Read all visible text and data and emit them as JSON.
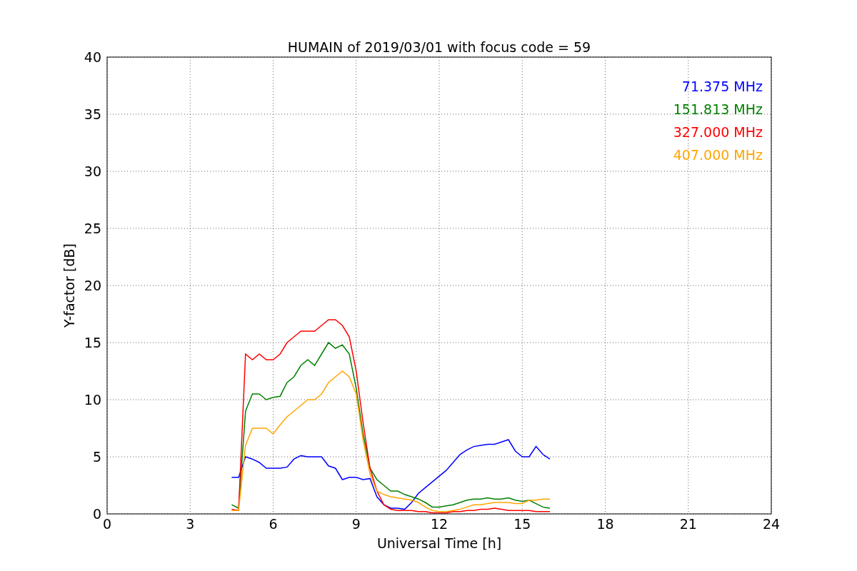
{
  "chart_data": {
    "type": "line",
    "title": "HUMAIN of 2019/03/01 with focus code = 59",
    "xlabel": "Universal Time [h]",
    "ylabel": "Y-factor [dB]",
    "x": [
      4.5,
      4.75,
      5,
      5.25,
      5.5,
      5.75,
      6,
      6.25,
      6.5,
      6.75,
      7,
      7.25,
      7.5,
      7.75,
      8,
      8.25,
      8.5,
      8.75,
      9,
      9.25,
      9.5,
      9.75,
      10,
      10.25,
      10.5,
      10.75,
      11,
      11.25,
      11.5,
      11.75,
      12,
      12.25,
      12.5,
      12.75,
      13,
      13.25,
      13.5,
      13.75,
      14,
      14.25,
      14.5,
      14.75,
      15,
      15.25,
      15.5,
      15.75,
      16
    ],
    "grid": true,
    "xlim": [
      0,
      24
    ],
    "ylim": [
      0,
      40
    ],
    "xticks": [
      0,
      3,
      6,
      9,
      12,
      15,
      18,
      21,
      24
    ],
    "yticks": [
      0,
      5,
      10,
      15,
      20,
      25,
      30,
      35,
      40
    ],
    "series": [
      {
        "name": "71.375 MHz",
        "color": "#0000ff",
        "values": [
          3.2,
          3.2,
          5,
          4.8,
          4.5,
          4,
          4,
          4,
          4.1,
          4.8,
          5.1,
          5,
          5,
          5,
          4.2,
          4,
          3,
          3.2,
          3.2,
          3,
          3.1,
          1.5,
          0.8,
          0.5,
          0.5,
          0.4,
          1,
          1.8,
          2.3,
          2.8,
          3.3,
          3.8,
          4.5,
          5.2,
          5.6,
          5.9,
          6,
          6.1,
          6.1,
          6.3,
          6.5,
          5.5,
          5,
          5,
          5.9,
          5.2,
          4.8
        ]
      },
      {
        "name": "151.813 MHz",
        "color": "#008000",
        "values": [
          0.8,
          0.5,
          9,
          10.5,
          10.5,
          10,
          10.2,
          10.3,
          11.5,
          12,
          13,
          13.5,
          13,
          14,
          15,
          14.5,
          14.8,
          14,
          11,
          7,
          4,
          3,
          2.5,
          2,
          2,
          1.7,
          1.5,
          1.3,
          1,
          0.6,
          0.6,
          0.7,
          0.8,
          1,
          1.2,
          1.3,
          1.3,
          1.4,
          1.3,
          1.3,
          1.4,
          1.2,
          1.1,
          1.2,
          0.9,
          0.6,
          0.5
        ]
      },
      {
        "name": "327.000 MHz",
        "color": "#ff0000",
        "values": [
          0.4,
          0.3,
          14,
          13.5,
          14,
          13.5,
          13.5,
          14,
          15,
          15.5,
          16,
          16,
          16,
          16.5,
          17,
          17,
          16.5,
          15.5,
          12.5,
          8,
          4,
          2,
          0.8,
          0.4,
          0.3,
          0.3,
          0.3,
          0.2,
          0.2,
          0.1,
          0.1,
          0.1,
          0.2,
          0.2,
          0.3,
          0.3,
          0.4,
          0.4,
          0.5,
          0.4,
          0.3,
          0.3,
          0.3,
          0.3,
          0.2,
          0.2,
          0.2
        ]
      },
      {
        "name": "407.000 MHz",
        "color": "#ffa500",
        "values": [
          0.3,
          0.3,
          6,
          7.5,
          7.5,
          7.5,
          7,
          7.8,
          8.5,
          9,
          9.5,
          10,
          10,
          10.5,
          11.5,
          12,
          12.5,
          12,
          10.5,
          6.5,
          3.5,
          2,
          1.7,
          1.5,
          1.4,
          1.3,
          1.2,
          1,
          0.6,
          0.3,
          0.2,
          0.2,
          0.3,
          0.4,
          0.6,
          0.8,
          0.8,
          0.9,
          1,
          1,
          1,
          0.9,
          0.9,
          1.2,
          1.2,
          1.3,
          1.3
        ]
      }
    ]
  }
}
